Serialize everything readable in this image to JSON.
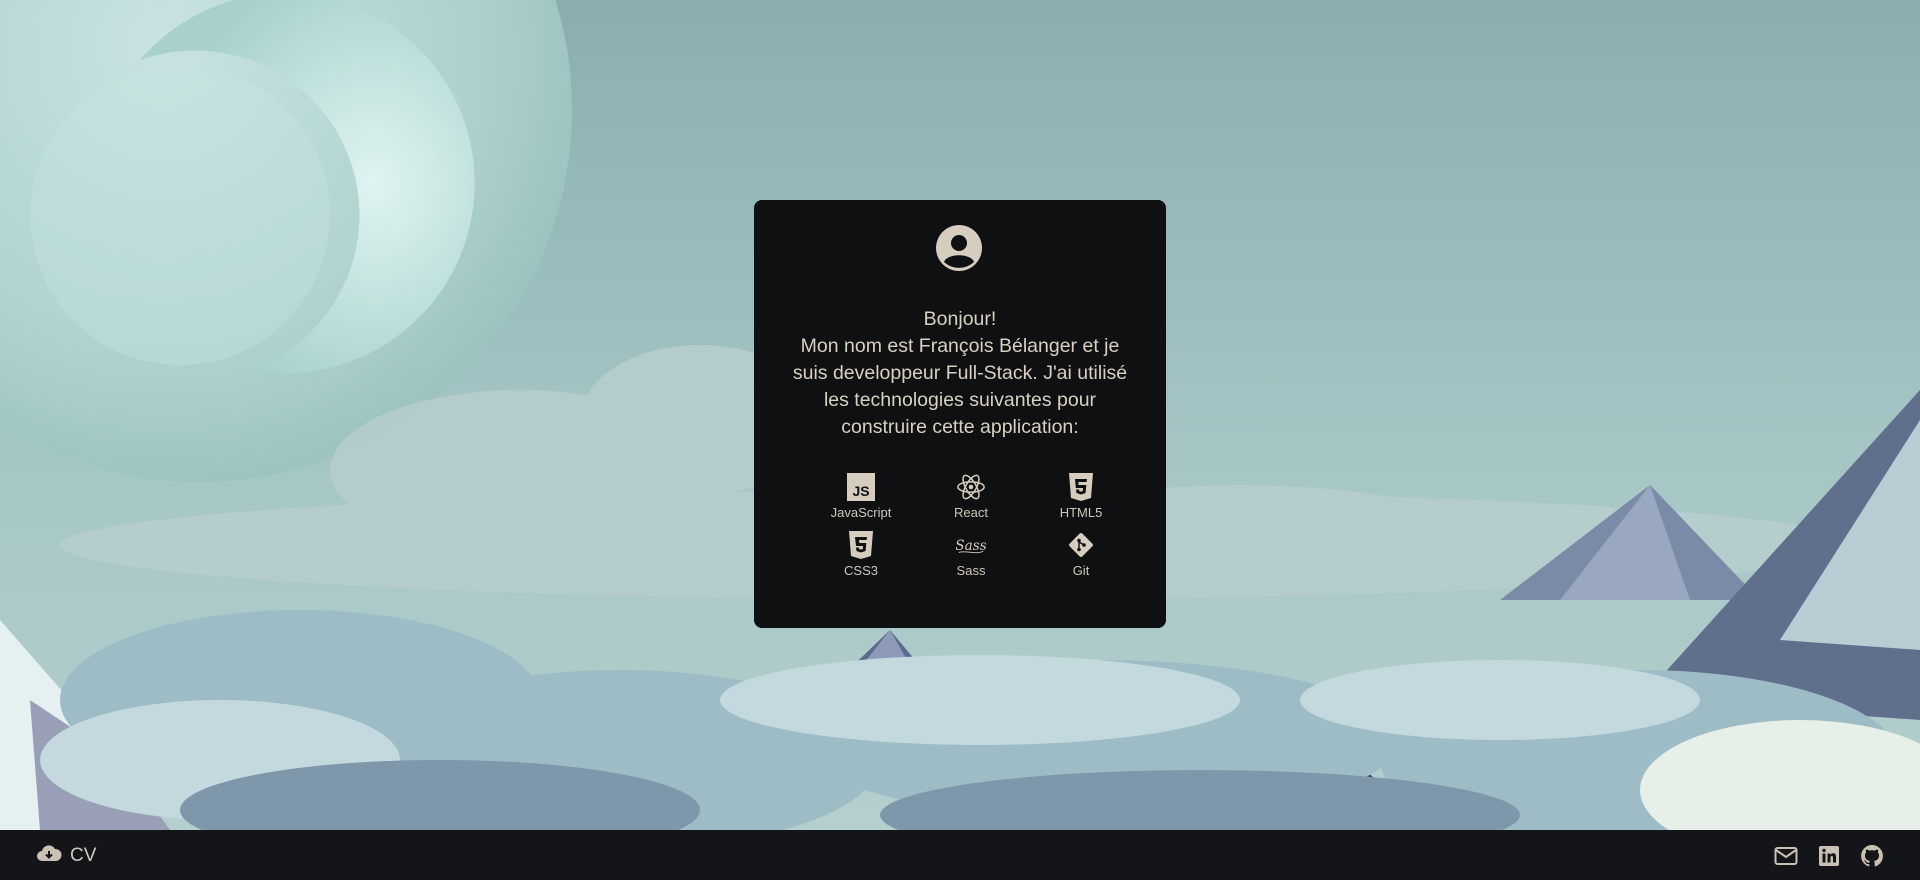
{
  "card": {
    "greeting": "Bonjour!",
    "intro_lines": [
      "Mon nom est François Bélanger et je",
      "suis developpeur Full-Stack. J'ai utilisé",
      "les technologies suivantes pour",
      "construire cette application:"
    ],
    "technologies": [
      {
        "label": "JavaScript",
        "icon": "javascript-icon"
      },
      {
        "label": "React",
        "icon": "react-icon"
      },
      {
        "label": "HTML5",
        "icon": "html5-icon"
      },
      {
        "label": "CSS3",
        "icon": "css3-icon"
      },
      {
        "label": "Sass",
        "icon": "sass-icon"
      },
      {
        "label": "Git",
        "icon": "git-icon"
      }
    ]
  },
  "footer": {
    "cv_label": "CV",
    "cv_icon": "cloud-download-icon",
    "social_icons": [
      "email-icon",
      "linkedin-icon",
      "github-icon"
    ]
  },
  "colors": {
    "card_bg": "#0f1012",
    "card_text": "#d9d0c2",
    "footer_bg": "#141518",
    "sky": "#8fb1b4"
  }
}
